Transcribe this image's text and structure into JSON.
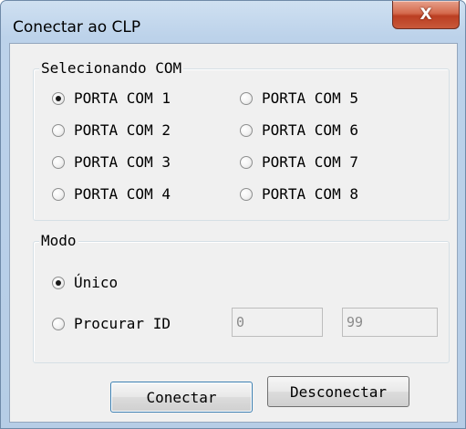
{
  "window": {
    "title": "Conectar ao CLP",
    "close_label": "X"
  },
  "com_group": {
    "legend": "Selecionando COM",
    "ports": [
      {
        "label": "PORTA COM 1",
        "checked": true
      },
      {
        "label": "PORTA COM 2",
        "checked": false
      },
      {
        "label": "PORTA COM 3",
        "checked": false
      },
      {
        "label": "PORTA COM 4",
        "checked": false
      },
      {
        "label": "PORTA COM 5",
        "checked": false
      },
      {
        "label": "PORTA COM 6",
        "checked": false
      },
      {
        "label": "PORTA COM 7",
        "checked": false
      },
      {
        "label": "PORTA COM 8",
        "checked": false
      }
    ]
  },
  "mode_group": {
    "legend": "Modo",
    "unique_label": "Único",
    "unique_checked": true,
    "search_label": "Procurar ID",
    "search_checked": false,
    "id_from": "0",
    "id_to": "99"
  },
  "buttons": {
    "connect": "Conectar",
    "disconnect": "Desconectar"
  }
}
